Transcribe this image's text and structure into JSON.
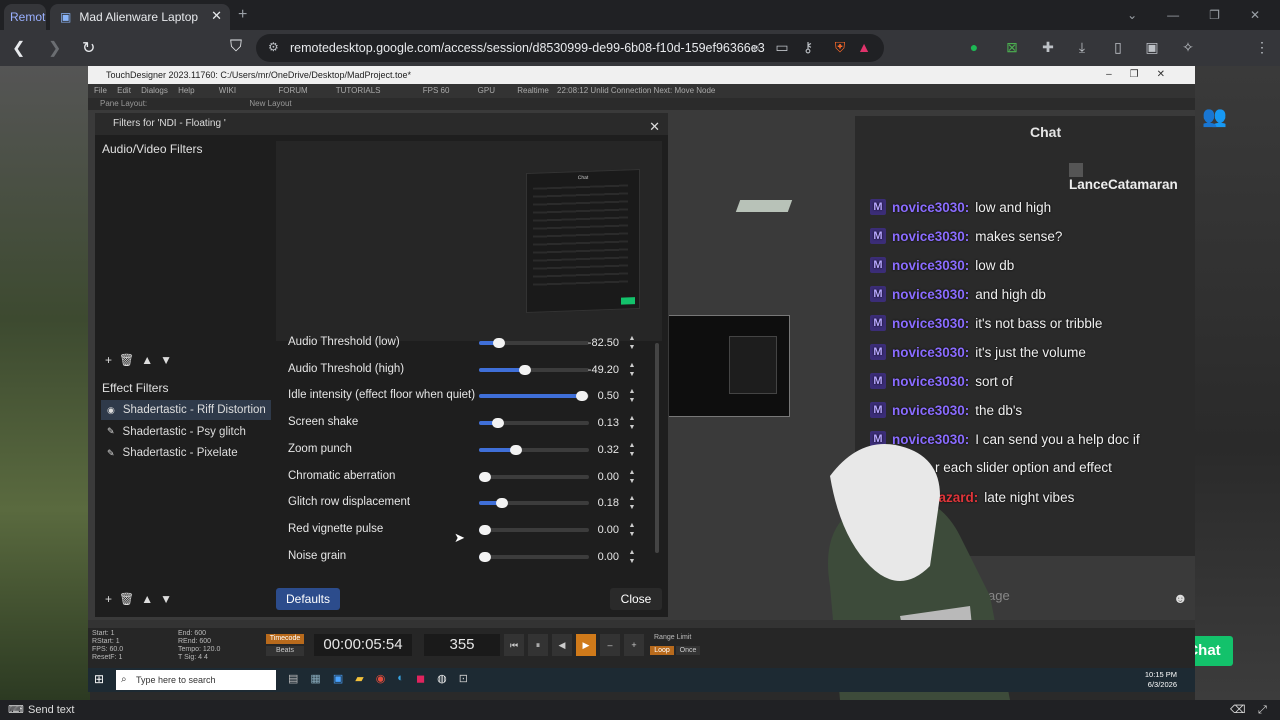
{
  "browser": {
    "tabs": [
      {
        "label": "Remot"
      },
      {
        "label": "Mad Alienware Laptop",
        "close": "✕"
      }
    ],
    "new_tab": "+",
    "window_controls": [
      "⌄",
      "—",
      "❐",
      "✕"
    ],
    "url": "remotedesktop.google.com/access/session/d8530999-de99-6b08-f10d-159ef96366e3"
  },
  "touchdesigner": {
    "title": "TouchDesigner 2023.11760: C:/Users/mr/OneDrive/Desktop/MadProject.toe*",
    "menu": [
      "File",
      "Edit",
      "Dialogs",
      "Help",
      "WIKI",
      "FORUM",
      "TUTORIALS",
      "FPS 60",
      "GPU",
      "Realtime",
      "22:08:12 Unlid  Connection  Next:  Move Node"
    ],
    "layout_label": "Pane Layout:",
    "new_layout": "New Layout"
  },
  "dialog": {
    "title": "Filters for 'NDI - Floating '",
    "av_section": "Audio/Video Filters",
    "effect_section": "Effect Filters",
    "effect_filters": [
      {
        "label": "Shadertastic - Riff Distortion",
        "selected": true,
        "icon": "eye-icon"
      },
      {
        "label": "Shadertastic - Psy glitch",
        "selected": false,
        "icon": "edit-icon"
      },
      {
        "label": "Shadertastic - Pixelate",
        "selected": false,
        "icon": "edit-icon"
      }
    ],
    "list_controls": [
      "+",
      "🗑",
      "▲",
      "▼"
    ],
    "properties": [
      {
        "label": "Audio Threshold (low)",
        "value": "-82.50",
        "level": 0.18
      },
      {
        "label": "Audio Threshold (high)",
        "value": "-49.20",
        "level": 0.42
      },
      {
        "label": "Idle intensity (effect floor when quiet)",
        "value": "0.50",
        "level": 0.94
      },
      {
        "label": "Screen shake",
        "value": "0.13",
        "level": 0.17
      },
      {
        "label": "Zoom punch",
        "value": "0.32",
        "level": 0.34
      },
      {
        "label": "Chromatic aberration",
        "value": "0.00",
        "level": 0.05
      },
      {
        "label": "Glitch row displacement",
        "value": "0.18",
        "level": 0.21
      },
      {
        "label": "Red vignette pulse",
        "value": "0.00",
        "level": 0.05
      },
      {
        "label": "Noise grain",
        "value": "0.00",
        "level": 0.05
      }
    ],
    "defaults_button": "Defaults",
    "close_button": "Close",
    "accent_color": "#3f6fd8"
  },
  "chat": {
    "title": "Chat",
    "top_user": "LanceCatamaran",
    "messages": [
      {
        "user": "novice3030:",
        "text": "low and high"
      },
      {
        "user": "novice3030:",
        "text": "makes sense?"
      },
      {
        "user": "novice3030:",
        "text": "low db"
      },
      {
        "user": "novice3030:",
        "text": "and high db"
      },
      {
        "user": "novice3030:",
        "text": "it's not bass or tribble"
      },
      {
        "user": "novice3030:",
        "text": "it's just the volume"
      },
      {
        "user": "novice3030:",
        "text": "sort of"
      },
      {
        "user": "novice3030:",
        "text": "the db's"
      },
      {
        "user": "novice3030:",
        "text": "I can send you a help doc if"
      },
      {
        "user": "",
        "text": "r each slider option and effect"
      },
      {
        "user": "WhosHazard:",
        "text": "late night vibes",
        "red": true
      }
    ],
    "input_placeholder": "ssage",
    "chat_button": "Chat",
    "brand_color": "#13c26b"
  },
  "timeline": {
    "left_info": [
      "Start: 1",
      "RStart: 1",
      "FPS: 60.0",
      "ResetF: 1"
    ],
    "mid_info": [
      "End: 600",
      "REnd: 600",
      "Tempo: 120.0",
      "T Sig: 4 4"
    ],
    "timecode_label": "Timecode",
    "beats_label": "Beats",
    "timecode": "00:00:05:54",
    "frame": "355",
    "range_limit": "Range Limit",
    "loop": "Loop",
    "once": "Once"
  },
  "taskbar": {
    "search_placeholder": "Type here to search",
    "time": "10:15 PM",
    "date": "6/3/2026"
  },
  "bottom": {
    "send_text": "Send text"
  }
}
